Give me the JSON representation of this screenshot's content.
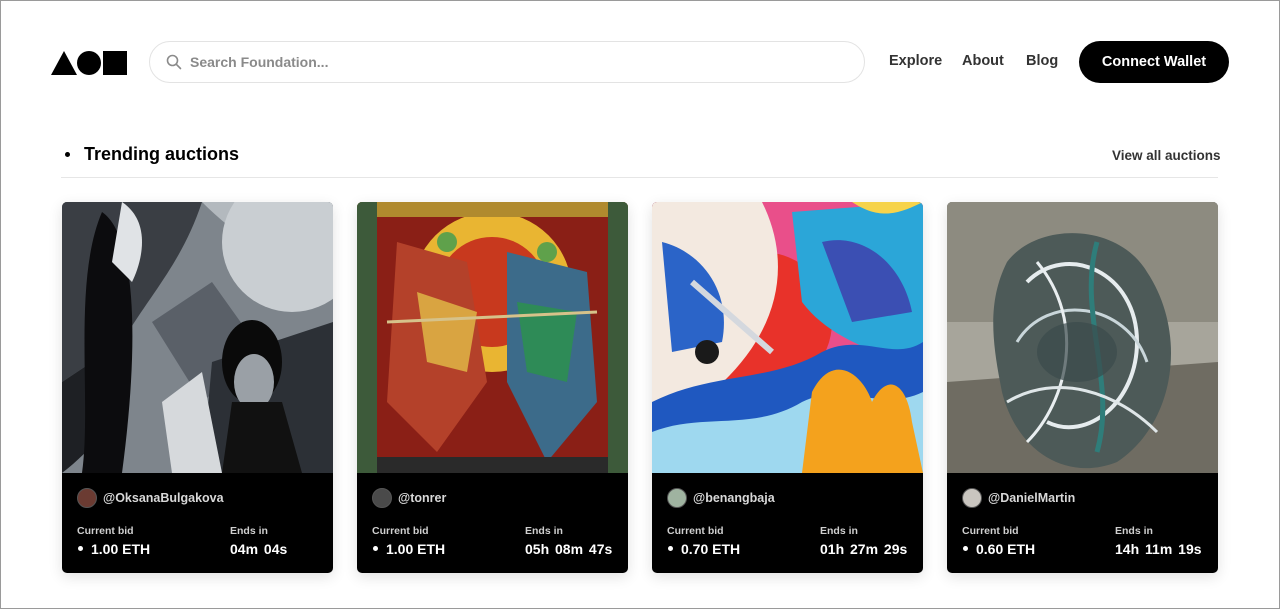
{
  "header": {
    "logo_icon": "foundation-logo-icon",
    "search": {
      "placeholder": "Search Foundation...",
      "value": "",
      "icon": "search-icon"
    },
    "nav": {
      "explore": "Explore",
      "about": "About",
      "blog": "Blog"
    },
    "connect_wallet": "Connect Wallet"
  },
  "section": {
    "title": "Trending auctions",
    "view_all": "View all auctions"
  },
  "cards": [
    {
      "creator": "@OksanaBulgakova",
      "bid_label": "Current bid",
      "bid": "1.00 ETH",
      "ends_label": "Ends in",
      "ends": "04m 04s"
    },
    {
      "creator": "@tonrer",
      "bid_label": "Current bid",
      "bid": "1.00 ETH",
      "ends_label": "Ends in",
      "ends": "05h 08m 47s"
    },
    {
      "creator": "@benangbaja",
      "bid_label": "Current bid",
      "bid": "0.70 ETH",
      "ends_label": "Ends in",
      "ends": "01h 27m 29s"
    },
    {
      "creator": "@DanielMartin",
      "bid_label": "Current bid",
      "bid": "0.60 ETH",
      "ends_label": "Ends in",
      "ends": "14h 11m 19s"
    }
  ],
  "colors": {
    "primary": "#000000",
    "card_background": "#000000",
    "muted_text": "#8a8a8a"
  }
}
